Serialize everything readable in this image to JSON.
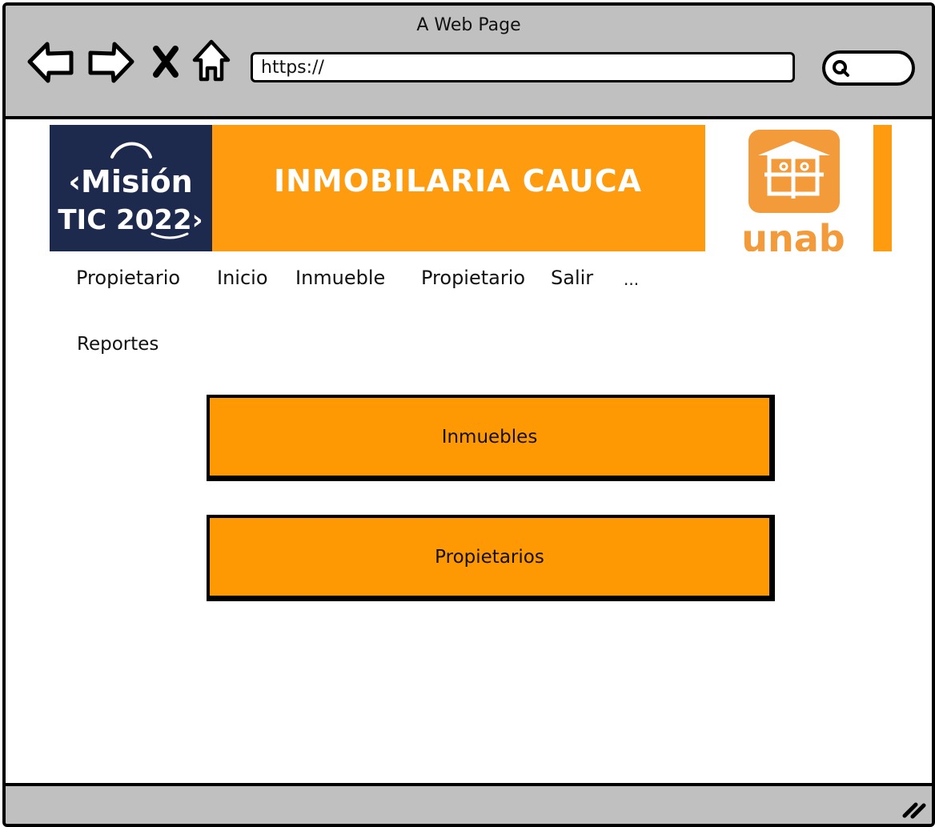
{
  "window": {
    "title": "A Web Page"
  },
  "browser": {
    "url": "https://",
    "buttons": {
      "back": "back-icon",
      "forward": "forward-icon",
      "close": "close-icon",
      "home": "home-icon",
      "search": "search-icon"
    }
  },
  "banner": {
    "left_logo_line1": "‹Misión",
    "left_logo_line2": "TIC 2022›",
    "title": "INMOBILARIA CAUCA",
    "right_logo_text": "unab",
    "colors": {
      "orange": "#fe9b0f",
      "navy": "#1d2a4e"
    }
  },
  "menu": {
    "items": [
      {
        "label": "Propietario"
      },
      {
        "label": "Inicio"
      },
      {
        "label": "Inmueble"
      },
      {
        "label": "Propietario"
      },
      {
        "label": "Salir"
      },
      {
        "label": "..."
      }
    ]
  },
  "page": {
    "section_label": "Reportes",
    "buttons": [
      {
        "label": "Inmuebles"
      },
      {
        "label": "Propietarios"
      }
    ],
    "button_color": "#fe9803"
  }
}
